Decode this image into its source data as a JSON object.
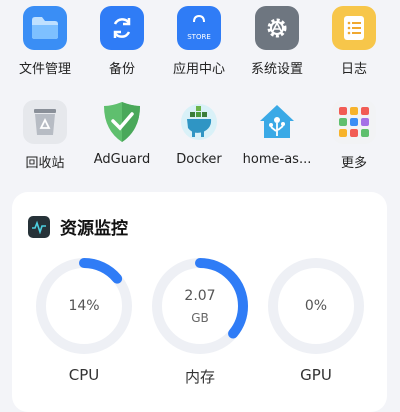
{
  "apps": [
    {
      "label": "文件管理",
      "icon": "folder-icon",
      "color": "#3a8ef5"
    },
    {
      "label": "备份",
      "icon": "sync-icon",
      "color": "#2f7cf6"
    },
    {
      "label": "应用中心",
      "icon": "store-bag-icon",
      "color": "#2f7cf6",
      "badge": "STORE"
    },
    {
      "label": "系统设置",
      "icon": "gear-icon",
      "color": "#6e7680"
    },
    {
      "label": "日志",
      "icon": "list-icon",
      "color": "#f7c64a"
    },
    {
      "label": "回收站",
      "icon": "recycle-icon",
      "color": "#e6e8ec"
    },
    {
      "label": "AdGuard",
      "icon": "shield-check-icon",
      "color": "#5fbf6e"
    },
    {
      "label": "Docker",
      "icon": "docker-icon",
      "color": "#2fa3c9"
    },
    {
      "label": "home-as...",
      "icon": "home-assistant-icon",
      "color": "#3aa9e6"
    },
    {
      "label": "更多",
      "icon": "more-apps-icon",
      "color": "#f2f3f5"
    }
  ],
  "monitor": {
    "title": "资源监控",
    "icon": "monitor-chart-icon",
    "gauges": [
      {
        "label": "CPU",
        "value": "14%",
        "unit": "",
        "fraction": 0.14
      },
      {
        "label": "内存",
        "value": "2.07",
        "unit": "GB",
        "fraction": 0.36
      },
      {
        "label": "GPU",
        "value": "0%",
        "unit": "",
        "fraction": 0.0
      }
    ]
  },
  "colors": {
    "accent": "#2f7cf6",
    "track": "#eef0f5"
  }
}
